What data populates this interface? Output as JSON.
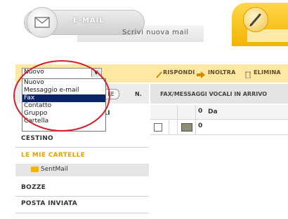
{
  "header": {
    "email_tab_label": "E-MAIL",
    "compose_label": "Scrivi nuova mail"
  },
  "toolbar": {
    "new_select": {
      "value": "Nuovo",
      "options": [
        "Nuovo",
        "Messaggio e-mail",
        "Fax",
        "Contatto",
        "Gruppo",
        "Cartella"
      ],
      "highlighted": "Fax"
    },
    "reply_label": "RISPONDI",
    "forward_label": "INOLTRA",
    "delete_label": "ELIMINA"
  },
  "sidebar": {
    "header_button": "LE",
    "column_n": "N.",
    "partial_item": "ALI",
    "items": [
      {
        "label": "CESTINO"
      },
      {
        "label": "LE MIE CARTELLE"
      },
      {
        "label": "SentMail"
      },
      {
        "label": "BOZZE"
      },
      {
        "label": "POSTA INVIATA"
      }
    ]
  },
  "main": {
    "title": "FAX/MESSAGGI VOCALI IN ARRIVO",
    "columns": {
      "from": "Da"
    }
  },
  "colors": {
    "toolbar_bg": "#ffe8a3",
    "accent_orange": "#f2b400",
    "folder_label": "#e8a300",
    "highlight": "#0a246a",
    "annotation": "#d1202a"
  }
}
